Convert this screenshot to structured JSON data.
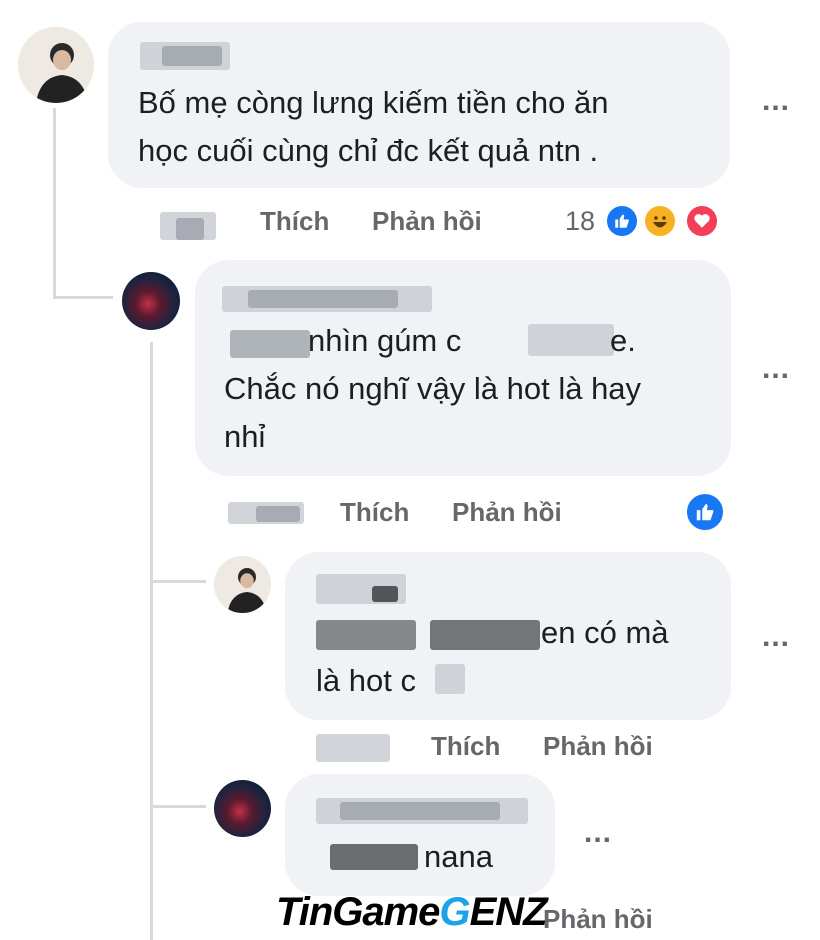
{
  "comments": [
    {
      "text_line1": "Bố mẹ còng lưng kiếm tiền cho ăn",
      "text_line2": "học cuối cùng chỉ đc kết quả ntn .",
      "like_label": "Thích",
      "reply_label": "Phản hồi",
      "reaction_count": "18",
      "reactions": [
        "like-icon",
        "haha-icon",
        "love-icon"
      ],
      "more_label": "..."
    },
    {
      "text_line1": "nhìn gúm c",
      "text_line1_end": "e.",
      "text_line2": "Chắc nó nghĩ vậy là hot là hay",
      "text_line3": "nhỉ",
      "like_label": "Thích",
      "reply_label": "Phản hồi",
      "reactions": [
        "like-icon"
      ],
      "more_label": "..."
    },
    {
      "text_line1": "en có mà",
      "text_line2": "là hot c",
      "like_label": "Thích",
      "reply_label": "Phản hồi",
      "more_label": "..."
    },
    {
      "text_line1": "nana",
      "reply_label": "Phản hồi",
      "more_label": "..."
    }
  ],
  "watermark": {
    "part1": "TinGame",
    "part2": "G",
    "part3": "ENZ",
    "accent_color": "#1aa3e8"
  },
  "colors": {
    "bubble": "#f0f2f5",
    "text": "#1c1e21",
    "secondary": "#65676b",
    "like_blue": "#1877f2"
  }
}
